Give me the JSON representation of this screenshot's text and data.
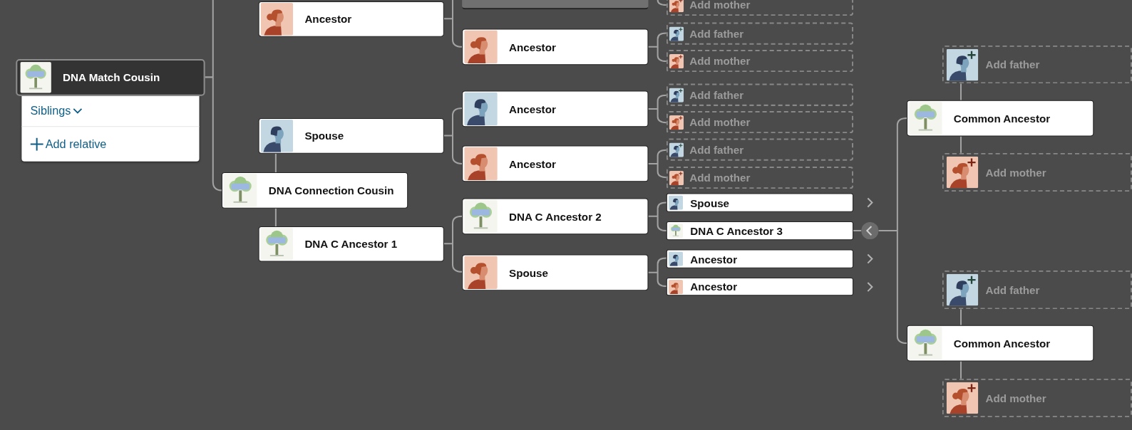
{
  "menu": {
    "items": [
      {
        "label": "Siblings",
        "kind": "dropdown"
      },
      {
        "label": "Add relative",
        "kind": "add"
      }
    ]
  },
  "nodes": [
    {
      "kind": "card",
      "name": "DNA Match Cousin",
      "avatar": {
        "kind": "dna"
      },
      "selected": true
    },
    {
      "kind": "card",
      "name": "Ancestor",
      "avatar": {
        "kind": "female"
      },
      "selected": false
    },
    {
      "kind": "card",
      "name": "Spouse",
      "avatar": {
        "kind": "male"
      },
      "selected": false
    },
    {
      "kind": "card",
      "name": "DNA Connection Cousin",
      "avatar": {
        "kind": "dna"
      },
      "selected": false
    },
    {
      "kind": "card",
      "name": "DNA C Ancestor 1",
      "avatar": {
        "kind": "dna"
      },
      "selected": false
    },
    {
      "kind": "partial",
      "selected": false
    },
    {
      "kind": "card",
      "name": "Ancestor",
      "avatar": {
        "kind": "female"
      },
      "selected": false
    },
    {
      "kind": "card",
      "name": "Ancestor",
      "avatar": {
        "kind": "male"
      },
      "selected": false
    },
    {
      "kind": "card",
      "name": "Ancestor",
      "avatar": {
        "kind": "female"
      },
      "selected": false
    },
    {
      "kind": "card",
      "name": "DNA C Ancestor 2",
      "avatar": {
        "kind": "dna"
      },
      "selected": false
    },
    {
      "kind": "card",
      "name": "Spouse",
      "avatar": {
        "kind": "female"
      },
      "selected": false
    },
    {
      "kind": "placeholder",
      "name": "Add mother",
      "avatar": {
        "kind": "female"
      },
      "selected": false
    },
    {
      "kind": "placeholder",
      "name": "Add father",
      "avatar": {
        "kind": "male"
      },
      "selected": false
    },
    {
      "kind": "placeholder",
      "name": "Add mother",
      "avatar": {
        "kind": "female"
      },
      "selected": false
    },
    {
      "kind": "placeholder",
      "name": "Add father",
      "avatar": {
        "kind": "male"
      },
      "selected": false
    },
    {
      "kind": "placeholder",
      "name": "Add mother",
      "avatar": {
        "kind": "female"
      },
      "selected": false
    },
    {
      "kind": "placeholder",
      "name": "Add father",
      "avatar": {
        "kind": "male"
      },
      "selected": false
    },
    {
      "kind": "placeholder",
      "name": "Add mother",
      "avatar": {
        "kind": "female"
      },
      "selected": false
    },
    {
      "kind": "small",
      "name": "Spouse",
      "avatar": {
        "kind": "male"
      },
      "selected": false,
      "expanded": false
    },
    {
      "kind": "small",
      "name": "DNA C Ancestor 3",
      "avatar": {
        "kind": "dna"
      },
      "selected": false,
      "expanded": true
    },
    {
      "kind": "small",
      "name": "Ancestor",
      "avatar": {
        "kind": "male"
      },
      "selected": false,
      "expanded": false
    },
    {
      "kind": "small",
      "name": "Ancestor",
      "avatar": {
        "kind": "female"
      },
      "selected": false,
      "expanded": false
    },
    {
      "kind": "placeholder",
      "name": "Add father",
      "avatar": {
        "kind": "male"
      },
      "selected": false
    },
    {
      "kind": "card",
      "name": "Common Ancestor",
      "avatar": {
        "kind": "dna"
      },
      "selected": false
    },
    {
      "kind": "placeholder",
      "name": "Add mother",
      "avatar": {
        "kind": "female"
      },
      "selected": false
    },
    {
      "kind": "placeholder",
      "name": "Add father",
      "avatar": {
        "kind": "male"
      },
      "selected": false
    },
    {
      "kind": "card",
      "name": "Common Ancestor",
      "avatar": {
        "kind": "dna"
      },
      "selected": false
    },
    {
      "kind": "placeholder",
      "name": "Add mother",
      "avatar": {
        "kind": "female"
      },
      "selected": false
    }
  ]
}
